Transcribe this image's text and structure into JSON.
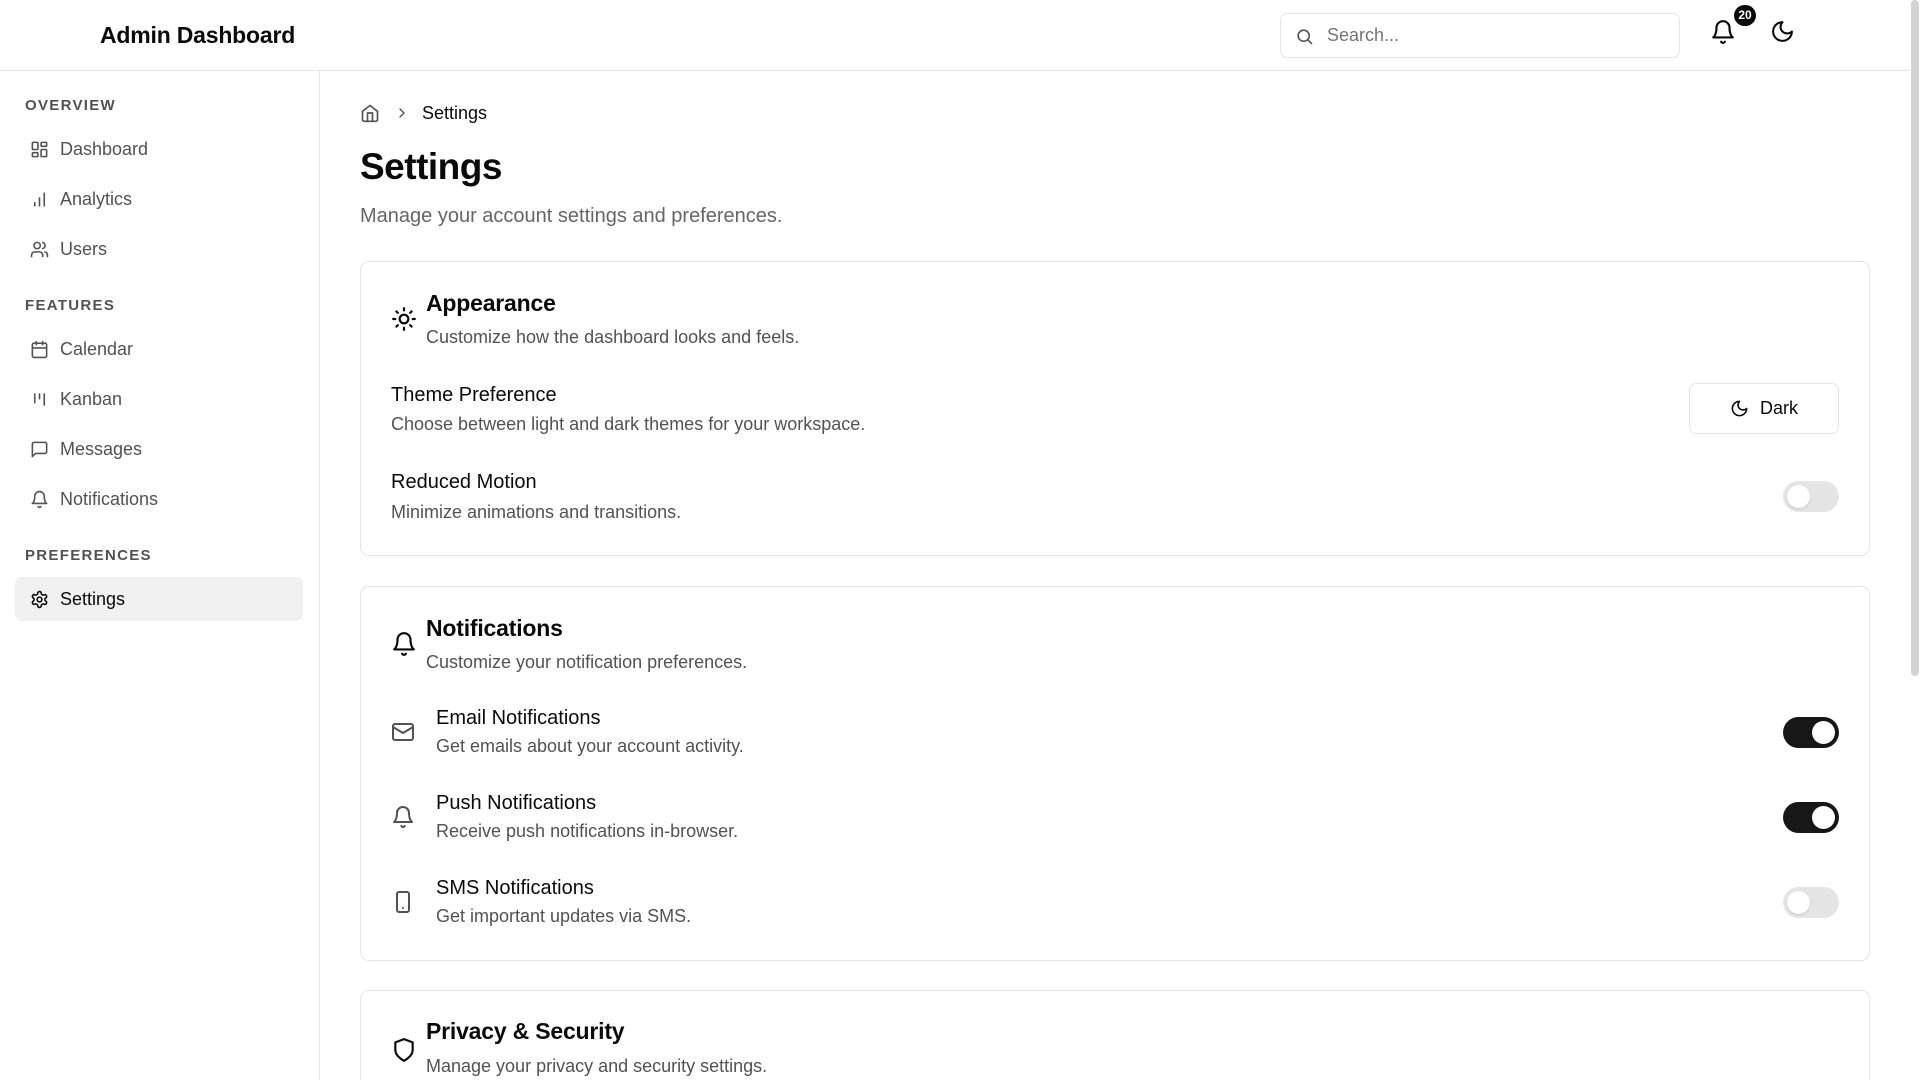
{
  "header": {
    "title": "Admin Dashboard",
    "search_placeholder": "Search...",
    "notification_count": "20"
  },
  "sidebar": {
    "sections": [
      {
        "label": "OVERVIEW",
        "items": [
          {
            "label": "Dashboard",
            "icon": "dashboard-icon"
          },
          {
            "label": "Analytics",
            "icon": "bar-chart-icon"
          },
          {
            "label": "Users",
            "icon": "users-icon"
          }
        ]
      },
      {
        "label": "FEATURES",
        "items": [
          {
            "label": "Calendar",
            "icon": "calendar-icon"
          },
          {
            "label": "Kanban",
            "icon": "kanban-icon"
          },
          {
            "label": "Messages",
            "icon": "message-icon"
          },
          {
            "label": "Notifications",
            "icon": "bell-icon"
          }
        ]
      },
      {
        "label": "PREFERENCES",
        "items": [
          {
            "label": "Settings",
            "icon": "gear-icon",
            "active": true
          }
        ]
      }
    ]
  },
  "breadcrumb": {
    "current": "Settings"
  },
  "page": {
    "title": "Settings",
    "subtitle": "Manage your account settings and preferences."
  },
  "appearance": {
    "title": "Appearance",
    "description": "Customize how the dashboard looks and feels.",
    "theme": {
      "title": "Theme Preference",
      "description": "Choose between light and dark themes for your workspace.",
      "button_label": "Dark"
    },
    "reduced_motion": {
      "title": "Reduced Motion",
      "description": "Minimize animations and transitions.",
      "enabled": false
    }
  },
  "notifications": {
    "title": "Notifications",
    "description": "Customize your notification preferences.",
    "items": [
      {
        "title": "Email Notifications",
        "description": "Get emails about your account activity.",
        "icon": "mail-icon",
        "enabled": true
      },
      {
        "title": "Push Notifications",
        "description": "Receive push notifications in-browser.",
        "icon": "bell-icon",
        "enabled": true
      },
      {
        "title": "SMS Notifications",
        "description": "Get important updates via SMS.",
        "icon": "smartphone-icon",
        "enabled": false
      }
    ]
  },
  "privacy": {
    "title": "Privacy & Security",
    "description": "Manage your privacy and security settings."
  },
  "colors": {
    "toggle_on": "#171717",
    "toggle_off": "#e5e5e5",
    "active_nav_bg": "#f1f1f1",
    "muted_text": "#525252",
    "border": "#e5e5e5"
  }
}
